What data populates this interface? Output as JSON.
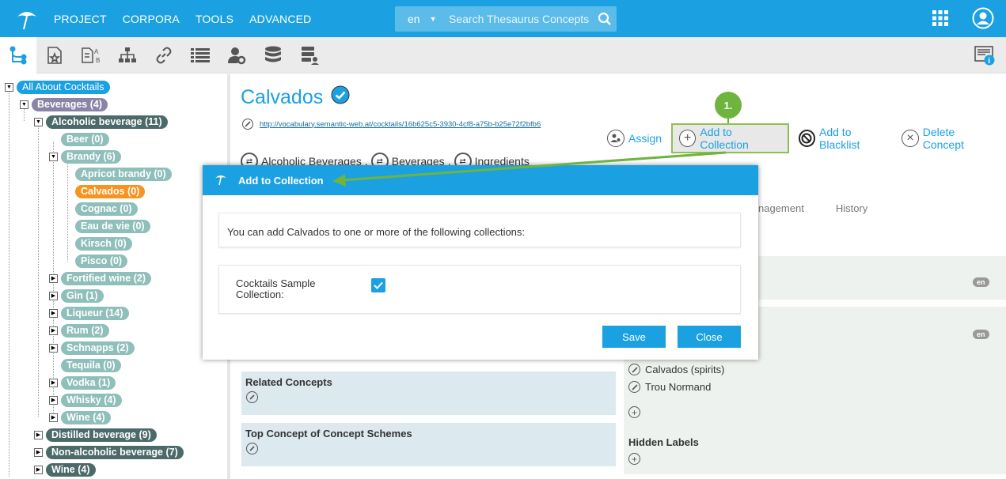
{
  "nav": {
    "items": [
      "PROJECT",
      "CORPORA",
      "TOOLS",
      "ADVANCED"
    ]
  },
  "search": {
    "lang": "en",
    "placeholder": "Search Thesaurus Concepts"
  },
  "tree": {
    "root": "All About Cocktails",
    "beverages": "Beverages (4)",
    "alcoholic": "Alcoholic beverage (11)",
    "beer": "Beer (0)",
    "brandy": "Brandy (6)",
    "apricot": "Apricot brandy (0)",
    "calvados": "Calvados (0)",
    "cognac": "Cognac (0)",
    "eaudevie": "Eau de vie (0)",
    "kirsch": "Kirsch (0)",
    "pisco": "Pisco (0)",
    "fortified": "Fortified wine (2)",
    "gin": "Gin (1)",
    "liqueur": "Liqueur (14)",
    "rum": "Rum (2)",
    "schnapps": "Schnapps (2)",
    "tequila": "Tequila (0)",
    "vodka": "Vodka (1)",
    "whisky": "Whisky (4)",
    "wine": "Wine (4)",
    "distilled": "Distilled beverage (9)",
    "nonalcoholic": "Non-alcoholic beverage (7)",
    "wine2": "Wine (4)"
  },
  "concept": {
    "title": "Calvados",
    "uri": "http://vocabulary.semantic-web.at/cocktails/16b625c5-3930-4cf8-a75b-b25e72f2bfb6"
  },
  "actions": {
    "assign": "Assign",
    "add_collection": "Add to Collection",
    "blacklist": "Add to Blacklist",
    "delete": "Delete Concept",
    "step": "1."
  },
  "broader": {
    "b1": "Alcoholic Beverages",
    "b2": "Beverages",
    "b3": "Ingredients"
  },
  "tabs": {
    "t1": "nagement",
    "t2": "History"
  },
  "labels": {
    "en": "en",
    "alt1": "Calvados (spirits)",
    "alt2": "Trou Normand",
    "hidden": "Hidden Labels"
  },
  "sections": {
    "related": "Related Concepts",
    "top": "Top Concept of Concept Schemes"
  },
  "modal": {
    "title": "Add to Collection",
    "text": "You can add Calvados to one or more of the following collections:",
    "collection": "Cocktails Sample Collection:",
    "save": "Save",
    "close": "Close"
  },
  "colors": {
    "accent": "#1ba1e2",
    "selected": "#f7931e",
    "highlight": "#8cc152"
  }
}
